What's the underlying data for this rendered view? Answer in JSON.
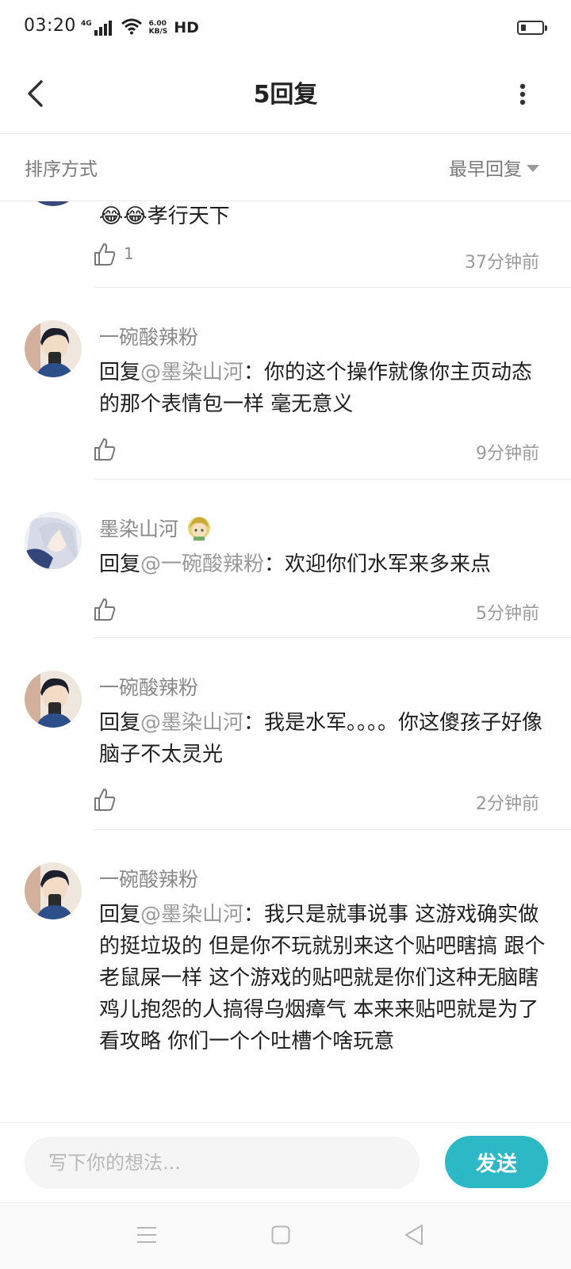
{
  "status_bar": {
    "time": "03:20",
    "network": "4G",
    "speed_value": "6.00",
    "speed_unit": "KB/S",
    "hd_label": "HD",
    "battery_level": 0.25,
    "icons": [
      "signal-icon",
      "wifi-icon",
      "battery-icon"
    ]
  },
  "header": {
    "title": "5回复",
    "back_icon": "back-arrow-icon",
    "more_icon": "more-vertical-icon"
  },
  "sort": {
    "label": "排序方式",
    "selected": "最早回复"
  },
  "comments": [
    {
      "username": "",
      "content_text": "😂😂孝行天下",
      "likes": "1",
      "time": "37分钟前"
    },
    {
      "username": "一碗酸辣粉",
      "reply_prefix": "回复",
      "mention": "@墨染山河",
      "content_text": "：你的这个操作就像你主页动态的那个表情包一样 毫无意义",
      "likes": "",
      "time": "9分钟前"
    },
    {
      "username": "墨染山河",
      "reply_prefix": "回复",
      "mention": "@一碗酸辣粉",
      "content_text": "：欢迎你们水军来多来点",
      "likes": "",
      "time": "5分钟前"
    },
    {
      "username": "一碗酸辣粉",
      "reply_prefix": "回复",
      "mention": "@墨染山河",
      "content_text": "：我是水军。。。。你这傻孩子好像脑子不太灵光",
      "likes": "",
      "time": "2分钟前"
    },
    {
      "username": "一碗酸辣粉",
      "reply_prefix": "回复",
      "mention": "@墨染山河",
      "content_text": "：我只是就事说事 这游戏确实做的挺垃圾的 但是你不玩就别来这个贴吧瞎搞 跟个老鼠屎一样 这个游戏的贴吧就是你们这种无脑瞎鸡儿抱怨的人搞得乌烟瘴气 本来来贴吧就是为了看攻略 你们一个个吐槽个啥玩意",
      "likes": "",
      "time": ""
    }
  ],
  "composer": {
    "placeholder": "写下你的想法...",
    "value": "",
    "send_label": "发送"
  },
  "colors": {
    "accent": "#2cb8c5",
    "muted_text": "#8a8a8a",
    "primary_text": "#1f1f1f"
  }
}
